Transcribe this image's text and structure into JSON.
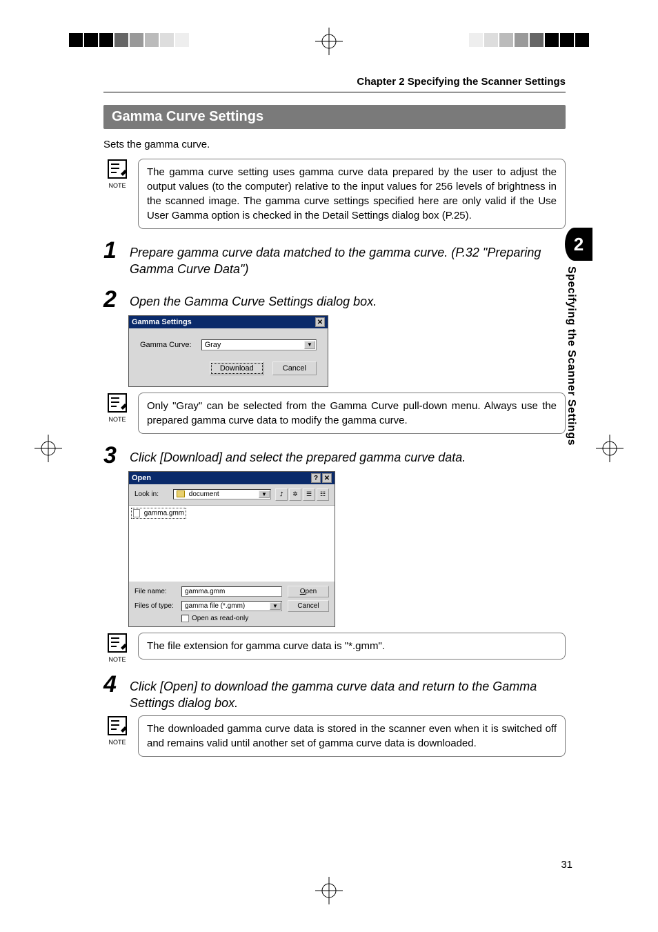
{
  "chapter_header": "Chapter 2 Specifying the Scanner Settings",
  "section_title": "Gamma Curve Settings",
  "intro": "Sets the gamma curve.",
  "note_label": "NOTE",
  "notes": {
    "n1": "The gamma curve setting uses gamma curve data prepared by the user to adjust the output values (to the computer) relative to the input values for 256 levels of brightness in the scanned image. The gamma curve settings specified here are only valid if the Use User Gamma option is checked in the Detail Settings dialog box (P.25).",
    "n2": "Only \"Gray\" can be selected from the Gamma Curve pull-down menu. Always use the prepared gamma curve data to modify the gamma curve.",
    "n3": "The file extension for gamma curve data is \"*.gmm\".",
    "n4": "The downloaded gamma curve data is stored in the scanner even when it is switched off and remains valid until another set of gamma curve data is downloaded."
  },
  "steps": {
    "s1_num": "1",
    "s1": "Prepare gamma curve data matched to the gamma curve. (P.32 \"Preparing Gamma Curve Data\")",
    "s2_num": "2",
    "s2": "Open the Gamma Curve Settings dialog box.",
    "s3_num": "3",
    "s3": "Click [Download] and select the prepared gamma curve data.",
    "s4_num": "4",
    "s4": "Click [Open] to download the gamma curve data and return to the Gamma Settings dialog box."
  },
  "gamma_dialog": {
    "title": "Gamma Settings",
    "label": "Gamma Curve:",
    "value": "Gray",
    "download": "Download",
    "cancel": "Cancel"
  },
  "open_dialog": {
    "title": "Open",
    "look_in": "Look in:",
    "folder": "document",
    "file": "gamma.gmm",
    "file_name_label": "File name:",
    "file_name": "gamma.gmm",
    "type_label": "Files of type:",
    "type": "gamma file (*.gmm)",
    "readonly": "Open as read-only",
    "open": "Open",
    "cancel": "Cancel"
  },
  "side_tab": {
    "num": "2",
    "text": "Specifying the Scanner Settings"
  },
  "page_number": "31"
}
